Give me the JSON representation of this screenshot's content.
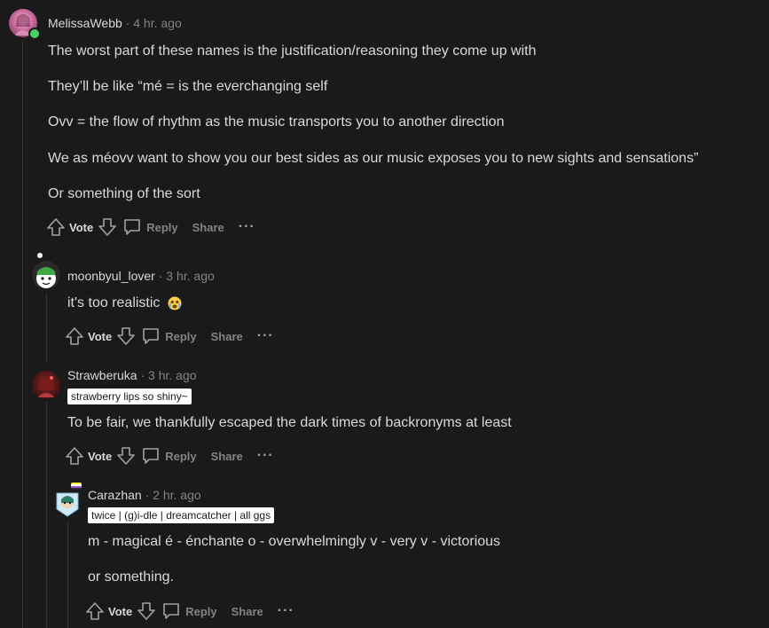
{
  "comments": [
    {
      "user": "MelissaWebb",
      "time": "4 hr. ago",
      "flair": "",
      "paragraphs": [
        "The worst part of these names is the justification/reasoning they come up with",
        "They’ll be like “mé = is the everchanging self",
        "Ovv = the flow of rhythm as the music transports you to another direction",
        "We as méovv want to show you our best sides as our music exposes you to new sights and sensations”",
        "Or something of the sort"
      ]
    },
    {
      "user": "moonbyul_lover",
      "time": "3 hr. ago",
      "flair": "",
      "paragraphs": [
        "it's too realistic"
      ]
    },
    {
      "user": "Strawberuka",
      "time": "3 hr. ago",
      "flair": "strawberry lips so shiny~",
      "paragraphs": [
        "To be fair, we thankfully escaped the dark times of backronyms at least"
      ]
    },
    {
      "user": "Carazhan",
      "time": "2 hr. ago",
      "flair": "twice | (g)i-dle | dreamcatcher | all ggs",
      "paragraphs": [
        "m - magical é - énchante o - overwhelmingly v - very v - victorious",
        "or something."
      ]
    }
  ],
  "actions": {
    "vote": "Vote",
    "reply": "Reply",
    "share": "Share",
    "more": "···"
  },
  "separator": "·",
  "icons": {
    "upvote": "arrow-up-icon",
    "downvote": "arrow-down-icon",
    "reply": "speech-bubble-icon",
    "emoji": "crying-face-emoji-icon"
  },
  "colors": {
    "background": "#1a1a1b",
    "text": "#d7dadc",
    "muted": "#818384",
    "thread_line": "#343536",
    "online": "#46d160"
  }
}
